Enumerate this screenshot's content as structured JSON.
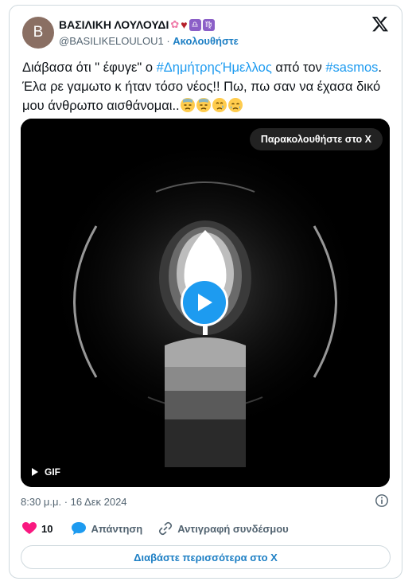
{
  "author": {
    "avatar_letter": "B",
    "name": "ΒΑΣΙΛΙΚΗ ΛΟΥΛΟΥΔΙ",
    "name_emojis": [
      "cherry-blossom",
      "red-heart",
      "libra-sign",
      "virgo-sign"
    ],
    "libra_glyph": "♎",
    "virgo_glyph": "♍",
    "handle": "@BASILIKELOULOU1",
    "separator": " · ",
    "follow_label": "Ακολουθήστε"
  },
  "tweet": {
    "text_part1": "Διάβασα ότι \" έφυγε\" ο ",
    "hashtag1": "#ΔημήτρηςΉμελλος",
    "text_part2": " από τον ",
    "hashtag2": "#sasmos",
    "text_part3": ". Έλα ρε γαμωτο κ ήταν τόσο νέος!! Πω, πω σαν να έχασα δικό μου άνθρωπο αισθάνομαι..",
    "emojis": [
      "downcast-face",
      "downcast-face",
      "crying-face",
      "sad-relieved-face"
    ]
  },
  "media": {
    "watch_label": "Παρακολουθήστε στο X",
    "gif_label": "GIF",
    "description_icon": "candle-gif"
  },
  "meta": {
    "timestamp": "8:30 μ.μ. · 16 Δεκ 2024"
  },
  "actions": {
    "like_count": "10",
    "reply_label": "Απάντηση",
    "copy_link_label": "Αντιγραφή συνδέσμου"
  },
  "read_more_label": "Διαβάστε περισσότερα στο X",
  "colors": {
    "link_blue": "#1d9bf0",
    "follow_blue": "#1d7fc4",
    "like_pink": "#f91880",
    "muted_gray": "#536471",
    "border": "#cfd9de"
  }
}
